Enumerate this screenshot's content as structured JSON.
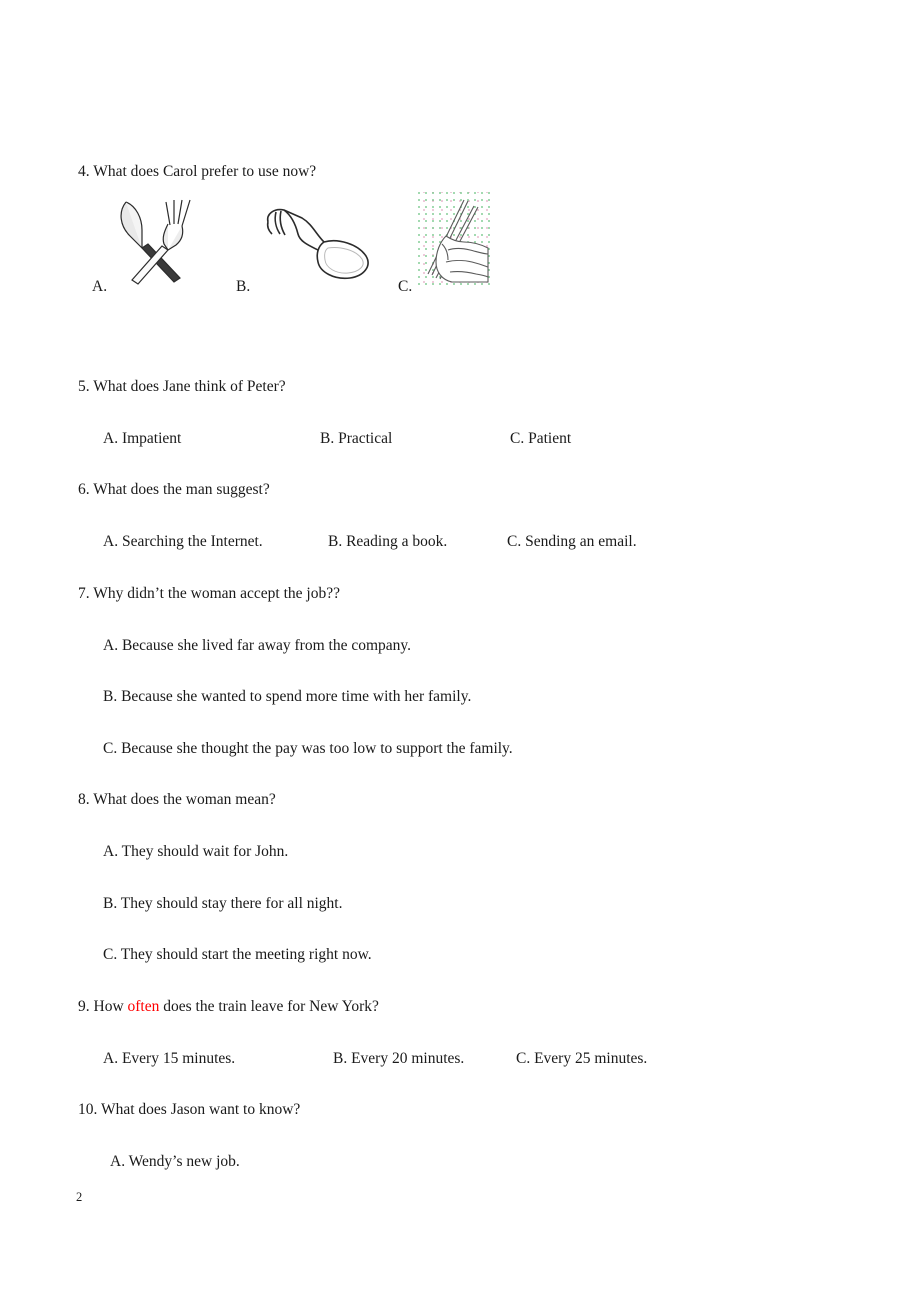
{
  "document": {
    "page_number": "2",
    "accent_red": "#ff0000",
    "text_color": "#1a1a1a",
    "background": "#ffffff"
  },
  "questions": [
    {
      "number": "4",
      "stem": "4. What does Carol prefer to use now?",
      "answer_style": "pictures",
      "choices": [
        {
          "label": "A.",
          "icon": "knife-and-fork-icon"
        },
        {
          "label": "B.",
          "icon": "spoon-icon"
        },
        {
          "label": "C.",
          "icon": "hand-holding-chopsticks-icon"
        }
      ]
    },
    {
      "number": "5",
      "stem": "5. What does Jane think of Peter?",
      "answer_style": "inline",
      "choices": [
        {
          "label": "A. Impatient"
        },
        {
          "label": "B. Practical"
        },
        {
          "label": "C. Patient"
        }
      ]
    },
    {
      "number": "6",
      "stem": "6. What does the man suggest?",
      "answer_style": "inline",
      "choices": [
        {
          "label": "A. Searching the Internet."
        },
        {
          "label": "B. Reading a book."
        },
        {
          "label": "C. Sending an email."
        }
      ]
    },
    {
      "number": "7",
      "stem": "7. Why didn’t the woman accept the job??",
      "answer_style": "stacked",
      "choices": [
        {
          "label": "A. Because she lived far away from the company."
        },
        {
          "label": "B. Because she wanted to spend more time with her family."
        },
        {
          "label": "C. Because she thought the pay was too low to support the family."
        }
      ]
    },
    {
      "number": "8",
      "stem": "8. What does the woman mean?",
      "answer_style": "stacked",
      "choices": [
        {
          "label": "A. They should wait for John."
        },
        {
          "label": "B. They should stay there for all night."
        },
        {
          "label": "C. They should start the meeting right now."
        }
      ]
    },
    {
      "number": "9",
      "stem_parts": {
        "before": "9. How ",
        "emphasis": "often",
        "after": " does the train leave for New York?"
      },
      "answer_style": "inline",
      "choices": [
        {
          "label": "A. Every 15 minutes."
        },
        {
          "label": "B. Every 20 minutes."
        },
        {
          "label": "C. Every 25 minutes."
        }
      ]
    },
    {
      "number": "10",
      "stem": "10. What does Jason want to know?",
      "answer_style": "stacked",
      "choices": [
        {
          "label": "A. Wendy’s new job."
        }
      ]
    }
  ]
}
